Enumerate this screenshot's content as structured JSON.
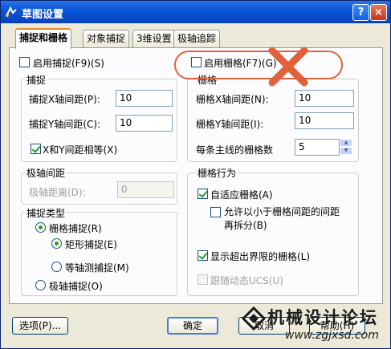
{
  "window": {
    "title": "草图设置",
    "help_button": "?",
    "close_button": "×"
  },
  "tabs": [
    "捕捉和栅格",
    "对象捕捉",
    "3维设置",
    "极轴追踪"
  ],
  "snap": {
    "enable_label": "启用捕捉(F9)(S)",
    "group_title": "捕捉",
    "x_spacing_label": "捕捉X轴间距(P):",
    "x_spacing_value": "10",
    "y_spacing_label": "捕捉Y轴间距(C):",
    "y_spacing_value": "10",
    "equal_label": "X和Y间距相等(X)"
  },
  "polar_spacing": {
    "group_title": "极轴间距",
    "distance_label": "极轴距离(D):",
    "distance_value": "0"
  },
  "snap_type": {
    "group_title": "捕捉类型",
    "grid_snap": "栅格捕捉(R)",
    "rect_snap": "矩形捕捉(E)",
    "iso_snap": "等轴测捕捉(M)",
    "polar_snap": "极轴捕捉(O)"
  },
  "grid": {
    "enable_label": "启用栅格(F7)(G)",
    "group_title": "栅格",
    "x_spacing_label": "栅格X轴间距(N):",
    "x_spacing_value": "10",
    "y_spacing_label": "栅格Y轴间距(I):",
    "y_spacing_value": "10",
    "major_label": "每条主线的栅格数",
    "major_value": "5"
  },
  "grid_behavior": {
    "group_title": "栅格行为",
    "adaptive": "自适应栅格(A)",
    "subdivide": "允许以小于栅格间距的间距再拆分(B)",
    "beyond_limits": "显示超出界限的栅格(L)",
    "follow_ucs": "跟随动态UCS(U)"
  },
  "buttons": {
    "options": "选项(P)...",
    "ok": "确定",
    "cancel": "取消",
    "help": "帮助(H)"
  },
  "watermark": {
    "line1": "机械设计论坛",
    "line2": "www.zgjxsd.com"
  },
  "colors": {
    "title_bar": "#0a55d8",
    "annotation": "#e0613a"
  }
}
